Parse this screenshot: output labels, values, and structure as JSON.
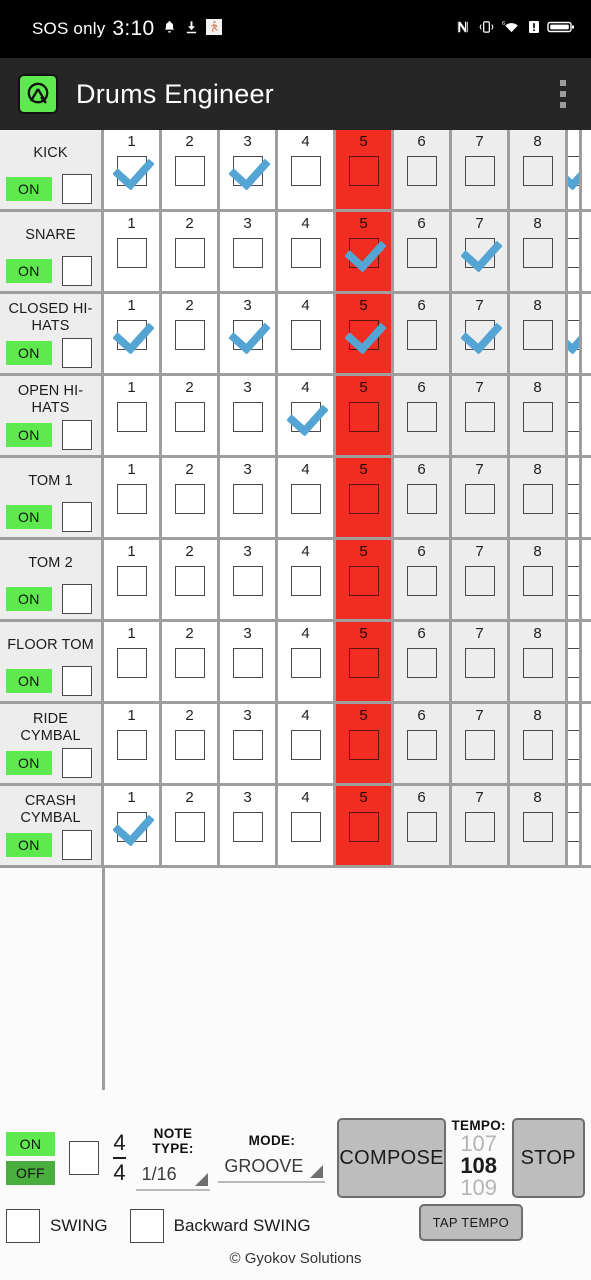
{
  "status_bar": {
    "carrier": "SOS only",
    "time": "3:10",
    "left_icons": [
      "bell-icon",
      "download-icon",
      "running-person-icon"
    ],
    "right_icons": [
      "nfc-icon",
      "vibrate-icon",
      "wifi-6-icon",
      "alert-icon",
      "battery-icon"
    ]
  },
  "app_bar": {
    "title": "Drums Engineer",
    "logo_name": "drums-engineer-logo",
    "overflow_name": "overflow-menu"
  },
  "grid": {
    "step_numbers": [
      "1",
      "2",
      "3",
      "4",
      "5",
      "6",
      "7",
      "8"
    ],
    "playhead_step": "5",
    "on_label": "ON",
    "colors": {
      "playhead": "#f02d20",
      "on_green": "#5eea4f",
      "check_blue": "#54a5d4",
      "shade": "#ededed",
      "gridline": "#9e9e9e"
    },
    "rows": [
      {
        "name": "KICK",
        "enabled": "ON",
        "steps": [
          1,
          0,
          1,
          0,
          0,
          0,
          0,
          0
        ],
        "step9": 1
      },
      {
        "name": "SNARE",
        "enabled": "ON",
        "steps": [
          0,
          0,
          0,
          0,
          1,
          0,
          1,
          0
        ],
        "step9": 0
      },
      {
        "name": "CLOSED HI-HATS",
        "enabled": "ON",
        "steps": [
          1,
          0,
          1,
          0,
          1,
          0,
          1,
          0
        ],
        "step9": 1
      },
      {
        "name": "OPEN HI-HATS",
        "enabled": "ON",
        "steps": [
          0,
          0,
          0,
          1,
          0,
          0,
          0,
          0
        ],
        "step9": 0
      },
      {
        "name": "TOM 1",
        "enabled": "ON",
        "steps": [
          0,
          0,
          0,
          0,
          0,
          0,
          0,
          0
        ],
        "step9": 0
      },
      {
        "name": "TOM 2",
        "enabled": "ON",
        "steps": [
          0,
          0,
          0,
          0,
          0,
          0,
          0,
          0
        ],
        "step9": 0
      },
      {
        "name": "FLOOR TOM",
        "enabled": "ON",
        "steps": [
          0,
          0,
          0,
          0,
          0,
          0,
          0,
          0
        ],
        "step9": 0
      },
      {
        "name": "RIDE CYMBAL",
        "enabled": "ON",
        "steps": [
          0,
          0,
          0,
          0,
          0,
          0,
          0,
          0
        ],
        "step9": 0
      },
      {
        "name": "CRASH CYMBAL",
        "enabled": "ON",
        "steps": [
          1,
          0,
          0,
          0,
          0,
          0,
          0,
          0
        ],
        "step9": 0
      }
    ]
  },
  "controls": {
    "metronome_on": "ON",
    "metronome_off": "OFF",
    "time_signature": {
      "top": "4",
      "bottom": "4"
    },
    "note_type": {
      "label": "NOTE TYPE:",
      "value": "1/16"
    },
    "mode": {
      "label": "MODE:",
      "value": "GROOVE"
    },
    "compose_label": "COMPOSE",
    "stop_label": "STOP",
    "tempo": {
      "label": "TEMPO:",
      "previous": "107",
      "current": "108",
      "next": "109"
    },
    "tap_tempo_label": "TAP TEMPO",
    "swing_label": "SWING",
    "backward_swing_label": "Backward SWING",
    "copyright": "© Gyokov Solutions"
  }
}
